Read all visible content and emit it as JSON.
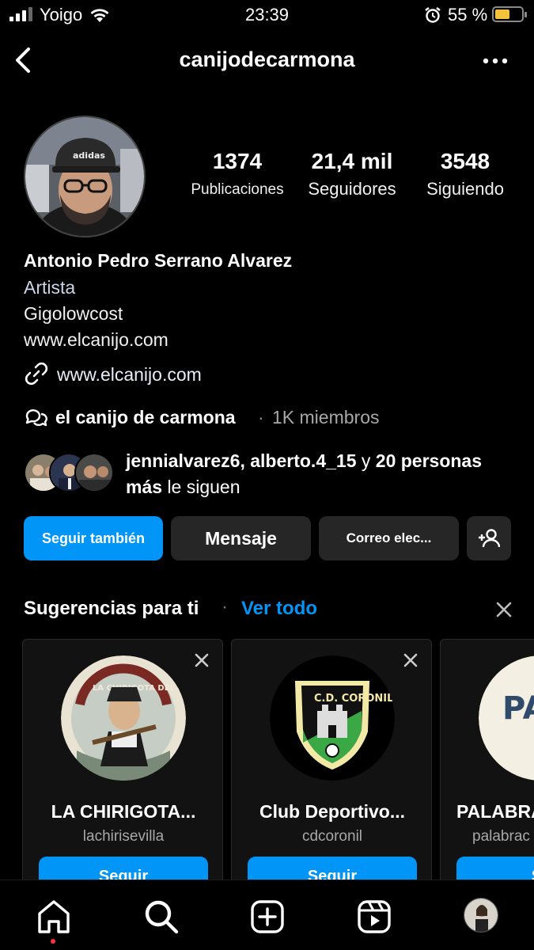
{
  "status_bar": {
    "carrier": "Yoigo",
    "time": "23:39",
    "battery_percent": "55 %",
    "battery_level": 0.55,
    "battery_color": "#f5c33b"
  },
  "header": {
    "title": "canijodecarmona",
    "back_icon": "chevron-left-icon",
    "more_icon": "ellipsis-icon"
  },
  "profile": {
    "stats": [
      {
        "value": "1374",
        "label": "Publicaciones"
      },
      {
        "value": "21,4 mil",
        "label": "Seguidores"
      },
      {
        "value": "3548",
        "label": "Siguiendo"
      }
    ],
    "name": "Antonio Pedro Serrano Alvarez",
    "category": "Artista",
    "bio_lines": [
      "Gigolowcost",
      "www.elcanijo.com"
    ],
    "link": "www.elcanijo.com",
    "community": {
      "name": "el canijo de carmona",
      "separator": "·",
      "members": "1K miembros"
    },
    "mutual": {
      "names": "jennialvarez6, alberto.4_15",
      "connector": "y",
      "count": "20 personas más",
      "suffix": "le siguen"
    }
  },
  "actions": {
    "follow": "Seguir también",
    "message": "Mensaje",
    "email": "Correo elec...",
    "add_user_icon": "add-person-icon"
  },
  "suggestions": {
    "title": "Sugerencias para ti",
    "separator": "·",
    "see_all": "Ver todo",
    "cards": [
      {
        "name": "LA CHIRIGOTA...",
        "username": "lachirisevilla",
        "button": "Seguir",
        "logo_text": "LA CHIRIGOTA DEL BARRANCO"
      },
      {
        "name": "Club Deportivo...",
        "username": "cdcoronil",
        "button": "Seguir",
        "logo_text": "C.D. CORONIL"
      },
      {
        "name": "PALABRA",
        "username": "palabrac",
        "button": "Se",
        "logo_text": "PALA de c"
      }
    ]
  },
  "tabbar": {
    "items": [
      "home-icon",
      "search-icon",
      "create-icon",
      "reels-icon",
      "profile-avatar"
    ],
    "notification_color": "#ff3040"
  },
  "colors": {
    "accent": "#0095f6",
    "background": "#000000",
    "button_dark": "#262626"
  }
}
